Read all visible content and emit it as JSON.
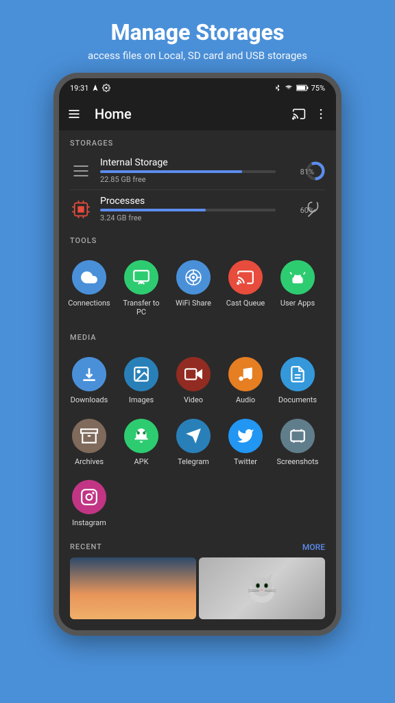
{
  "header": {
    "title": "Manage Storages",
    "subtitle": "access files on Local, SD card and USB storages"
  },
  "statusBar": {
    "time": "19:31",
    "battery": "75%"
  },
  "appBar": {
    "title": "Home"
  },
  "storages": {
    "sectionLabel": "STORAGES",
    "items": [
      {
        "name": "Internal Storage",
        "free": "22.85 GB free",
        "percent": 81,
        "percentLabel": "81%"
      },
      {
        "name": "Processes",
        "free": "3.24 GB free",
        "percent": 60,
        "percentLabel": "60%"
      }
    ]
  },
  "tools": {
    "sectionLabel": "TOOLS",
    "items": [
      {
        "label": "Connections",
        "color": "#4A90D9"
      },
      {
        "label": "Transfer to PC",
        "color": "#2ecc71"
      },
      {
        "label": "WiFi Share",
        "color": "#4A90D9"
      },
      {
        "label": "Cast Queue",
        "color": "#e74c3c"
      },
      {
        "label": "User Apps",
        "color": "#2ecc71"
      }
    ]
  },
  "media": {
    "sectionLabel": "MEDIA",
    "items": [
      {
        "label": "Downloads",
        "color": "#4A90D9"
      },
      {
        "label": "Images",
        "color": "#4A90D9"
      },
      {
        "label": "Video",
        "color": "#c0392b"
      },
      {
        "label": "Audio",
        "color": "#e67e22"
      },
      {
        "label": "Documents",
        "color": "#3498db"
      },
      {
        "label": "Archives",
        "color": "#7f6a5b"
      },
      {
        "label": "APK",
        "color": "#2ecc71"
      },
      {
        "label": "Telegram",
        "color": "#3498db"
      },
      {
        "label": "Twitter",
        "color": "#2196F3"
      },
      {
        "label": "Screenshots",
        "color": "#607d8b"
      },
      {
        "label": "Instagram",
        "color": "#c13584"
      }
    ]
  },
  "recent": {
    "sectionLabel": "RECENT",
    "moreLabel": "MORE"
  }
}
